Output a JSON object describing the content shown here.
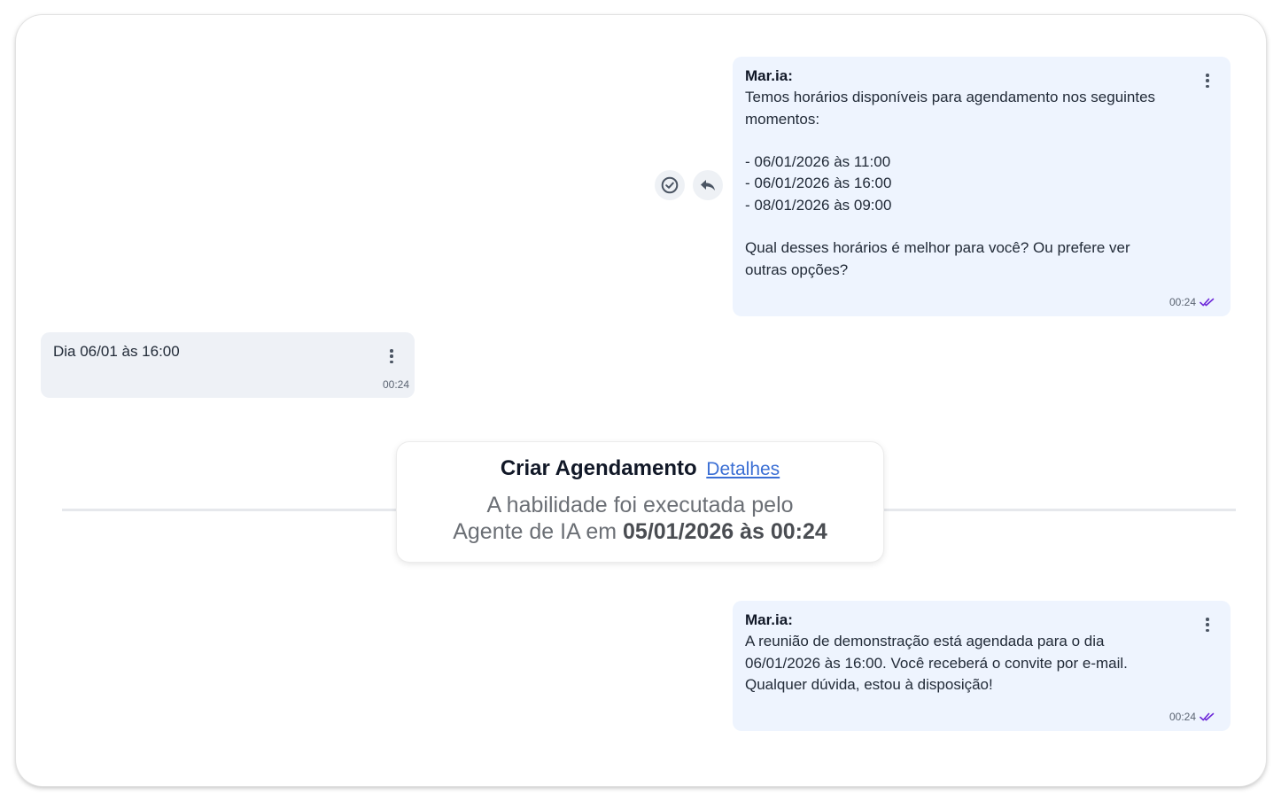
{
  "messages": [
    {
      "sender": "Mar.ia:",
      "text": "Temos horários disponíveis para agendamento nos seguintes\nmomentos:\n\n- 06/01/2026 às 11:00\n- 06/01/2026 às 16:00\n- 08/01/2026 às 09:00\n\nQual desses horários é melhor para você? Ou prefere ver\noutras opções?",
      "time": "00:24",
      "status_icon": "double-check-icon"
    },
    {
      "text": "Dia 06/01 às 16:00",
      "time": "00:24"
    },
    {
      "sender": "Mar.ia:",
      "text": "A reunião de demonstração está agendada para o dia\n06/01/2026 às 16:00. Você receberá o convite por e-mail.\nQualquer dúvida, estou à disposição!",
      "time": "00:24",
      "status_icon": "double-check-icon"
    }
  ],
  "skill_event": {
    "title": "Criar Agendamento",
    "link": "Detalhes",
    "desc_line1": "A habilidade foi executada pelo",
    "desc_line2_prefix": "Agente de IA em ",
    "desc_line2_bold": "05/01/2026 às 00:24"
  },
  "message_actions": [
    "check-circle-icon",
    "reply-icon"
  ],
  "colors": {
    "outgoing_bubble": "#eef4fe",
    "incoming_bubble": "#eef1f6",
    "read_ticks": "#6d28d9",
    "link": "#3b6fd4"
  }
}
